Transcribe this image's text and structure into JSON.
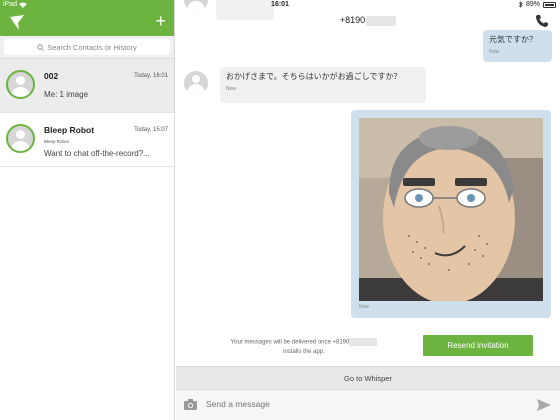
{
  "status": {
    "device": "iPad",
    "time": "16:01",
    "battery": "89%"
  },
  "sidebar": {
    "search_placeholder": "Search Contacts or History",
    "contacts": [
      {
        "name": "002",
        "time": "Today, 16:01",
        "subtitle": "",
        "preview": "Me: 1 image"
      },
      {
        "name": "Bleep Robot",
        "time": "Today, 15:07",
        "subtitle": "Bleep Robot",
        "preview": "Want to chat off-the-record?..."
      }
    ]
  },
  "conversation": {
    "title": "+8190",
    "messages": [
      {
        "text": "元気ですか？",
        "meta": "Now"
      },
      {
        "text": "おかげさまで。そちらはいかがお過ごしですか？",
        "meta": "Now"
      },
      {
        "meta": "Now"
      }
    ],
    "notice_line1": "Your messages will be delivered once +8190",
    "notice_line2": "installs the app.",
    "resend_label": "Resend invitation",
    "goto_label": "Go to Whisper",
    "input_placeholder": "Send a message"
  },
  "colors": {
    "brand_green": "#6cb33f",
    "outgoing_bubble": "#cfe0ec",
    "incoming_bubble": "#f0f0f0"
  }
}
